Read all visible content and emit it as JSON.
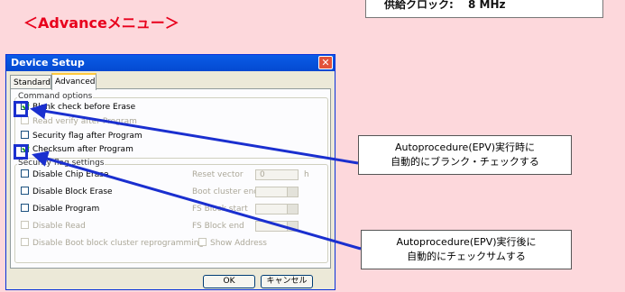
{
  "heading": "＜Advanceメニュー＞",
  "top_box": {
    "text": "供給クロック:　 8 MHz"
  },
  "dialog": {
    "title": "Device Setup",
    "close_label": "✕",
    "tabs": [
      "Standard",
      "Advanced"
    ],
    "command_group": {
      "label": "Command options",
      "items": [
        {
          "label": "Blank check before Erase",
          "checked": true,
          "enabled": true
        },
        {
          "label": "Read verify after Program",
          "checked": false,
          "enabled": false
        },
        {
          "label": "Security flag after Program",
          "checked": false,
          "enabled": true
        },
        {
          "label": "Checksum after Program",
          "checked": true,
          "enabled": true
        }
      ]
    },
    "security_group": {
      "label": "Security flag settings",
      "items": [
        {
          "label": "Disable Chip Erase",
          "enabled": true
        },
        {
          "label": "Disable Block Erase",
          "enabled": true
        },
        {
          "label": "Disable Program",
          "enabled": true
        },
        {
          "label": "Disable Read",
          "enabled": false
        },
        {
          "label": "Disable Boot block cluster reprogramming",
          "enabled": false
        }
      ],
      "reset_vector_label": "Reset vector",
      "reset_vector_value": "0",
      "reset_vector_unit": "h",
      "boot_cluster_label": "Boot cluster end",
      "fs_start_label": "FS Block start",
      "fs_end_label": "FS Block end",
      "show_address_label": "Show Address"
    },
    "ok_label": "OK",
    "cancel_label": "キャンセル"
  },
  "callouts": [
    {
      "line1": "Autoprocedure(EPV)実行時に",
      "line2": "自動的にブランク・チェックする"
    },
    {
      "line1": "Autoprocedure(EPV)実行後に",
      "line2": "自動的にチェックサムする"
    }
  ],
  "colors": {
    "background": "#fdd8dc",
    "heading": "#e8001c",
    "highlight": "#1a2fcf"
  }
}
